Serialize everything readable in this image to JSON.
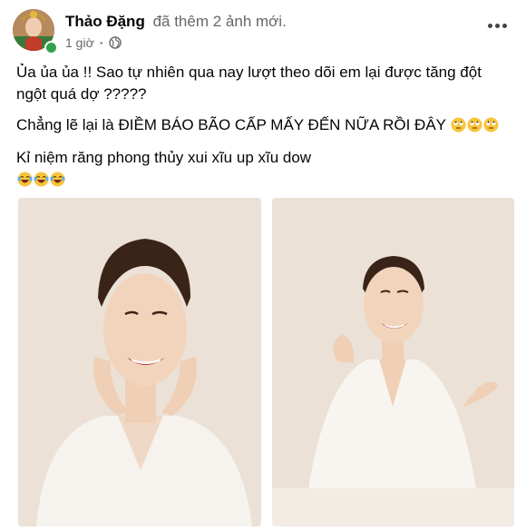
{
  "post": {
    "author": {
      "name": "Thảo Đặng",
      "action": "đã thêm 2 ảnh mới.",
      "online": true
    },
    "meta": {
      "time": "1 giờ",
      "separator": "·",
      "privacy_icon": "globe-icon"
    },
    "menu_icon": "more-horizontal-icon",
    "text": {
      "line1": "Ủa ủa ủa !! Sao tự nhiên qua nay lượt theo dõi em lại được tăng đột ngột quá dợ ?????",
      "line2": "Chẳng lẽ lại là ĐIỀM BÁO BÃO CẤP MẤY ĐẾN NỮA RỒI ĐÂY",
      "line2_emojis": [
        "rolling-eyes-emoji",
        "rolling-eyes-emoji",
        "rolling-eyes-emoji"
      ],
      "line3": "Kỉ niệm răng phong thủy xui xĩu up xĩu dow",
      "line3_emojis": [
        "laughing-tears-emoji",
        "laughing-tears-emoji",
        "laughing-tears-emoji"
      ]
    },
    "photos": [
      {
        "subject": "woman-smiling-hands-on-face"
      },
      {
        "subject": "woman-smiling-seated-at-table"
      }
    ],
    "colors": {
      "online": "#31a24c",
      "secondary_text": "#65676b",
      "photo_background": "#ebe1d7"
    }
  }
}
